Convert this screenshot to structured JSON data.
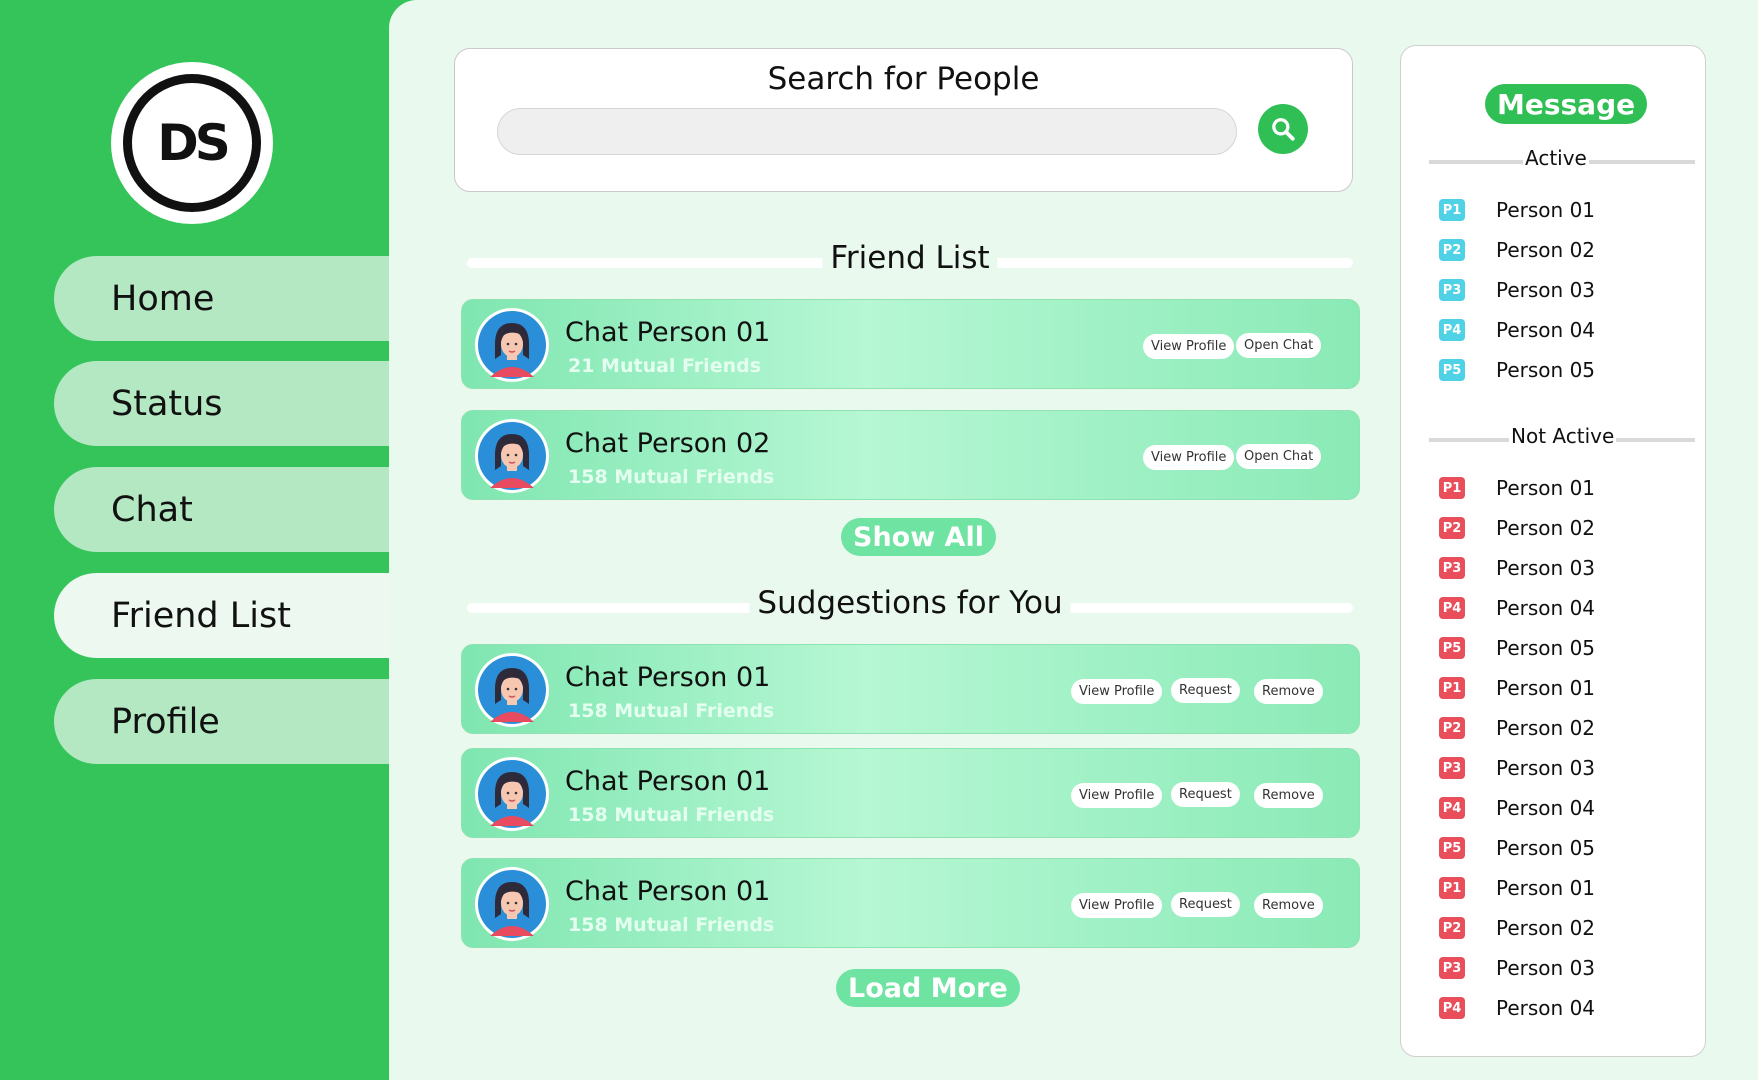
{
  "logo": {
    "text": "DS"
  },
  "nav": {
    "items": [
      {
        "label": "Home"
      },
      {
        "label": "Status"
      },
      {
        "label": "Chat"
      },
      {
        "label": "Friend List"
      },
      {
        "label": "Profile"
      }
    ],
    "active": "Friend List"
  },
  "search": {
    "title": "Search for People",
    "value": "",
    "placeholder": ""
  },
  "friends": {
    "title": "Friend List",
    "items": [
      {
        "name": "Chat Person 01",
        "mutual": "21 Mutual Friends",
        "view_label": "View Profile",
        "chat_label": "Open Chat"
      },
      {
        "name": "Chat Person 02",
        "mutual": "158 Mutual Friends",
        "view_label": "View Profile",
        "chat_label": "Open Chat"
      }
    ],
    "show_all_label": "Show All"
  },
  "suggestions": {
    "title": "Sudgestions for You",
    "items": [
      {
        "name": "Chat Person 01",
        "mutual": "158 Mutual Friends",
        "view_label": "View Profile",
        "request_label": "Request",
        "remove_label": "Remove"
      },
      {
        "name": "Chat Person 01",
        "mutual": "158 Mutual Friends",
        "view_label": "View Profile",
        "request_label": "Request",
        "remove_label": "Remove"
      },
      {
        "name": "Chat Person 01",
        "mutual": "158 Mutual Friends",
        "view_label": "View Profile",
        "request_label": "Request",
        "remove_label": "Remove"
      }
    ],
    "load_more_label": "Load More"
  },
  "messages": {
    "title": "Message",
    "active_label": "Active",
    "active": [
      {
        "badge": "P1",
        "name": "Person 01"
      },
      {
        "badge": "P2",
        "name": "Person 02"
      },
      {
        "badge": "P3",
        "name": "Person 03"
      },
      {
        "badge": "P4",
        "name": "Person 04"
      },
      {
        "badge": "P5",
        "name": "Person 05"
      }
    ],
    "inactive_label": "Not Active",
    "inactive": [
      {
        "badge": "P1",
        "name": "Person 01"
      },
      {
        "badge": "P2",
        "name": "Person 02"
      },
      {
        "badge": "P3",
        "name": "Person 03"
      },
      {
        "badge": "P4",
        "name": "Person 04"
      },
      {
        "badge": "P5",
        "name": "Person 05"
      },
      {
        "badge": "P1",
        "name": "Person 01"
      },
      {
        "badge": "P2",
        "name": "Person 02"
      },
      {
        "badge": "P3",
        "name": "Person 03"
      },
      {
        "badge": "P4",
        "name": "Person 04"
      },
      {
        "badge": "P5",
        "name": "Person 05"
      },
      {
        "badge": "P1",
        "name": "Person 01"
      },
      {
        "badge": "P2",
        "name": "Person 02"
      },
      {
        "badge": "P3",
        "name": "Person 03"
      },
      {
        "badge": "P4",
        "name": "Person 04"
      }
    ]
  },
  "colors": {
    "sidebar": "#34c45a",
    "main_bg": "#e9f9ee",
    "accent": "#2fbf55",
    "active_badge": "#4fd1e6",
    "inactive_badge": "#e94e5b"
  },
  "icons": {
    "search": "search-icon",
    "avatar": "user-avatar-icon"
  }
}
